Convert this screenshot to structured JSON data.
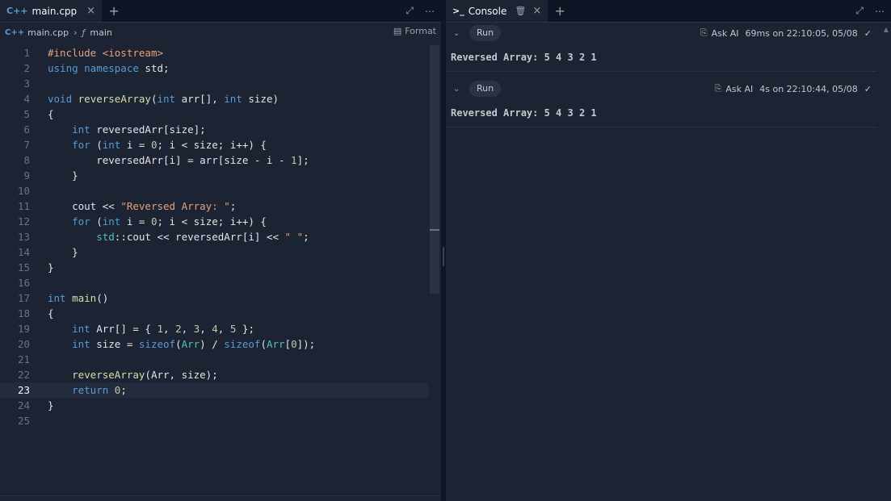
{
  "editor": {
    "tab": {
      "icon": "C++",
      "label": "main.cpp",
      "close": "×"
    },
    "add_tab": "+",
    "breadcrumb": {
      "icon": "C++",
      "file": "main.cpp",
      "sep": "›",
      "fn_icon": "ƒ",
      "symbol": "main"
    },
    "format_label": "Format",
    "active_line": 23,
    "lines": [
      [
        [
          "inc",
          "#include "
        ],
        [
          "str",
          "<iostream>"
        ]
      ],
      [
        [
          "kw",
          "using namespace"
        ],
        [
          "p",
          " std;"
        ]
      ],
      [],
      [
        [
          "kw",
          "void"
        ],
        [
          "p",
          " "
        ],
        [
          "fn",
          "reverseArray"
        ],
        [
          "p",
          "("
        ],
        [
          "kw",
          "int"
        ],
        [
          "p",
          " arr[], "
        ],
        [
          "kw",
          "int"
        ],
        [
          "p",
          " size)"
        ]
      ],
      [
        [
          "p",
          "{"
        ]
      ],
      [
        [
          "p",
          "    "
        ],
        [
          "kw",
          "int"
        ],
        [
          "p",
          " reversedArr[size];"
        ]
      ],
      [
        [
          "p",
          "    "
        ],
        [
          "kw",
          "for"
        ],
        [
          "p",
          " ("
        ],
        [
          "kw",
          "int"
        ],
        [
          "p",
          " i = "
        ],
        [
          "num",
          "0"
        ],
        [
          "p",
          "; i < size; i++) {"
        ]
      ],
      [
        [
          "p",
          "        reversedArr[i] = arr[size - i - "
        ],
        [
          "num",
          "1"
        ],
        [
          "p",
          "];"
        ]
      ],
      [
        [
          "p",
          "    }"
        ]
      ],
      [],
      [
        [
          "p",
          "    cout << "
        ],
        [
          "str",
          "\"Reversed Array: \""
        ],
        [
          "p",
          ";"
        ]
      ],
      [
        [
          "p",
          "    "
        ],
        [
          "kw",
          "for"
        ],
        [
          "p",
          " ("
        ],
        [
          "kw",
          "int"
        ],
        [
          "p",
          " i = "
        ],
        [
          "num",
          "0"
        ],
        [
          "p",
          "; i < size; i++) {"
        ]
      ],
      [
        [
          "p",
          "        "
        ],
        [
          "typ",
          "std"
        ],
        [
          "p",
          "::cout << reversedArr[i] << "
        ],
        [
          "str",
          "\" \""
        ],
        [
          "p",
          ";"
        ]
      ],
      [
        [
          "p",
          "    }"
        ]
      ],
      [
        [
          "p",
          "}"
        ]
      ],
      [],
      [
        [
          "kw",
          "int"
        ],
        [
          "p",
          " "
        ],
        [
          "fn",
          "main"
        ],
        [
          "p",
          "()"
        ]
      ],
      [
        [
          "p",
          "{"
        ]
      ],
      [
        [
          "p",
          "    "
        ],
        [
          "kw",
          "int"
        ],
        [
          "p",
          " Arr[] = { "
        ],
        [
          "num",
          "1"
        ],
        [
          "p",
          ", "
        ],
        [
          "num",
          "2"
        ],
        [
          "p",
          ", "
        ],
        [
          "num",
          "3"
        ],
        [
          "p",
          ", "
        ],
        [
          "num",
          "4"
        ],
        [
          "p",
          ", "
        ],
        [
          "num",
          "5"
        ],
        [
          "p",
          " };"
        ]
      ],
      [
        [
          "p",
          "    "
        ],
        [
          "kw",
          "int"
        ],
        [
          "p",
          " size = "
        ],
        [
          "kw",
          "sizeof"
        ],
        [
          "p",
          "("
        ],
        [
          "typ",
          "Arr"
        ],
        [
          "p",
          ") / "
        ],
        [
          "kw",
          "sizeof"
        ],
        [
          "p",
          "("
        ],
        [
          "typ",
          "Arr"
        ],
        [
          "p",
          "["
        ],
        [
          "num",
          "0"
        ],
        [
          "p",
          "]);"
        ]
      ],
      [],
      [
        [
          "p",
          "    "
        ],
        [
          "fn",
          "reverseArray"
        ],
        [
          "p",
          "(Arr, size);"
        ]
      ],
      [
        [
          "p",
          "    "
        ],
        [
          "kw",
          "return"
        ],
        [
          "p",
          " "
        ],
        [
          "num",
          "0"
        ],
        [
          "p",
          ";"
        ]
      ],
      [
        [
          "p",
          "}"
        ]
      ],
      []
    ]
  },
  "console": {
    "tab": {
      "icon": ">_",
      "label": "Console",
      "trash": "🗑",
      "close": "×"
    },
    "add_tab": "+",
    "runs": [
      {
        "run_label": "Run",
        "ask_ai": "Ask AI",
        "meta": "69ms on 22:10:05, 05/08",
        "check": "✓",
        "output": "Reversed Array: 5 4 3 2 1"
      },
      {
        "run_label": "Run",
        "ask_ai": "Ask AI",
        "meta": "4s on 22:10:44, 05/08",
        "check": "✓",
        "output": "Reversed Array: 5 4 3 2 1"
      }
    ]
  },
  "icons": {
    "expand": "⤢",
    "more": "⋯",
    "chevron": "⌄"
  },
  "colors": {
    "background": "#1c2333",
    "keyword": "#569cd6",
    "function": "#dcdcaa",
    "string": "#e5a27a",
    "number": "#b5cea8",
    "type": "#4ec9b0",
    "cpp_icon": "#569cd6"
  }
}
